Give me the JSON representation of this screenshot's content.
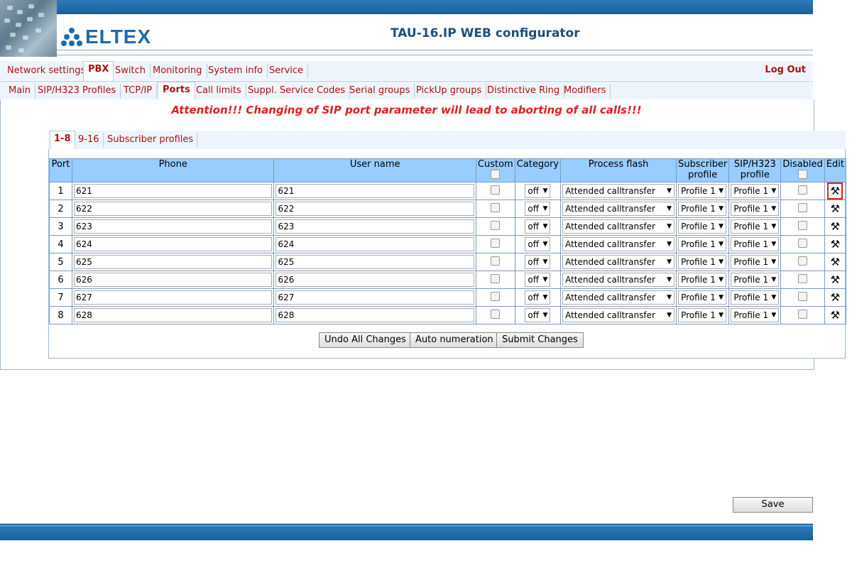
{
  "header": {
    "logo_text": "ELTEX",
    "app_title": "TAU-16.IP WEB configurator"
  },
  "menu": {
    "items": [
      {
        "label": "Network settings"
      },
      {
        "label": "PBX"
      },
      {
        "label": "Switch"
      },
      {
        "label": "Monitoring"
      },
      {
        "label": "System info"
      },
      {
        "label": "Service"
      }
    ],
    "active": "PBX",
    "logout": "Log Out"
  },
  "submenu": {
    "items": [
      {
        "label": "Main"
      },
      {
        "label": "SIP/H323 Profiles"
      },
      {
        "label": "TCP/IP"
      },
      {
        "label": "Ports"
      },
      {
        "label": "Call limits"
      },
      {
        "label": "Suppl. Service Codes"
      },
      {
        "label": "Serial groups"
      },
      {
        "label": "PickUp groups"
      },
      {
        "label": "Distinctive Ring"
      },
      {
        "label": "Modifiers"
      }
    ],
    "active": "Ports"
  },
  "attention": "Attention!!! Changing of SIP port parameter will lead to aborting of all calls!!!",
  "tabs": [
    {
      "label": "1-8"
    },
    {
      "label": "9-16"
    },
    {
      "label": "Subscriber profiles"
    }
  ],
  "table": {
    "headers": {
      "port": "Port",
      "phone": "Phone",
      "username": "User name",
      "custom": "Custom",
      "category": "Category",
      "process_flash": "Process flash",
      "subscriber_profile_1": "Subscriber",
      "subscriber_profile_2": "profile",
      "sip_profile_1": "SIP/H323",
      "sip_profile_2": "profile",
      "disabled": "Disabled",
      "edit": "Edit"
    },
    "rows": [
      {
        "port": "1",
        "phone": "621",
        "username": "621",
        "category": "off",
        "flash": "Attended calltransfer",
        "sub_profile": "Profile 1",
        "sip_profile": "Profile 1"
      },
      {
        "port": "2",
        "phone": "622",
        "username": "622",
        "category": "off",
        "flash": "Attended calltransfer",
        "sub_profile": "Profile 1",
        "sip_profile": "Profile 1"
      },
      {
        "port": "3",
        "phone": "623",
        "username": "623",
        "category": "off",
        "flash": "Attended calltransfer",
        "sub_profile": "Profile 1",
        "sip_profile": "Profile 1"
      },
      {
        "port": "4",
        "phone": "624",
        "username": "624",
        "category": "off",
        "flash": "Attended calltransfer",
        "sub_profile": "Profile 1",
        "sip_profile": "Profile 1"
      },
      {
        "port": "5",
        "phone": "625",
        "username": "625",
        "category": "off",
        "flash": "Attended calltransfer",
        "sub_profile": "Profile 1",
        "sip_profile": "Profile 1"
      },
      {
        "port": "6",
        "phone": "626",
        "username": "626",
        "category": "off",
        "flash": "Attended calltransfer",
        "sub_profile": "Profile 1",
        "sip_profile": "Profile 1"
      },
      {
        "port": "7",
        "phone": "627",
        "username": "627",
        "category": "off",
        "flash": "Attended calltransfer",
        "sub_profile": "Profile 1",
        "sip_profile": "Profile 1"
      },
      {
        "port": "8",
        "phone": "628",
        "username": "628",
        "category": "off",
        "flash": "Attended calltransfer",
        "sub_profile": "Profile 1",
        "sip_profile": "Profile 1"
      }
    ]
  },
  "buttons": {
    "undo": "Undo All Changes",
    "auto": "Auto numeration",
    "submit": "Submit Changes",
    "save": "Save"
  },
  "icons": {
    "edit": "tools-icon",
    "dropdown": "chevron-down-icon"
  },
  "colors": {
    "brand": "#1f6aa8",
    "menu_text": "#aa1111",
    "attention": "#e02020",
    "table_header": "#99ccff"
  }
}
